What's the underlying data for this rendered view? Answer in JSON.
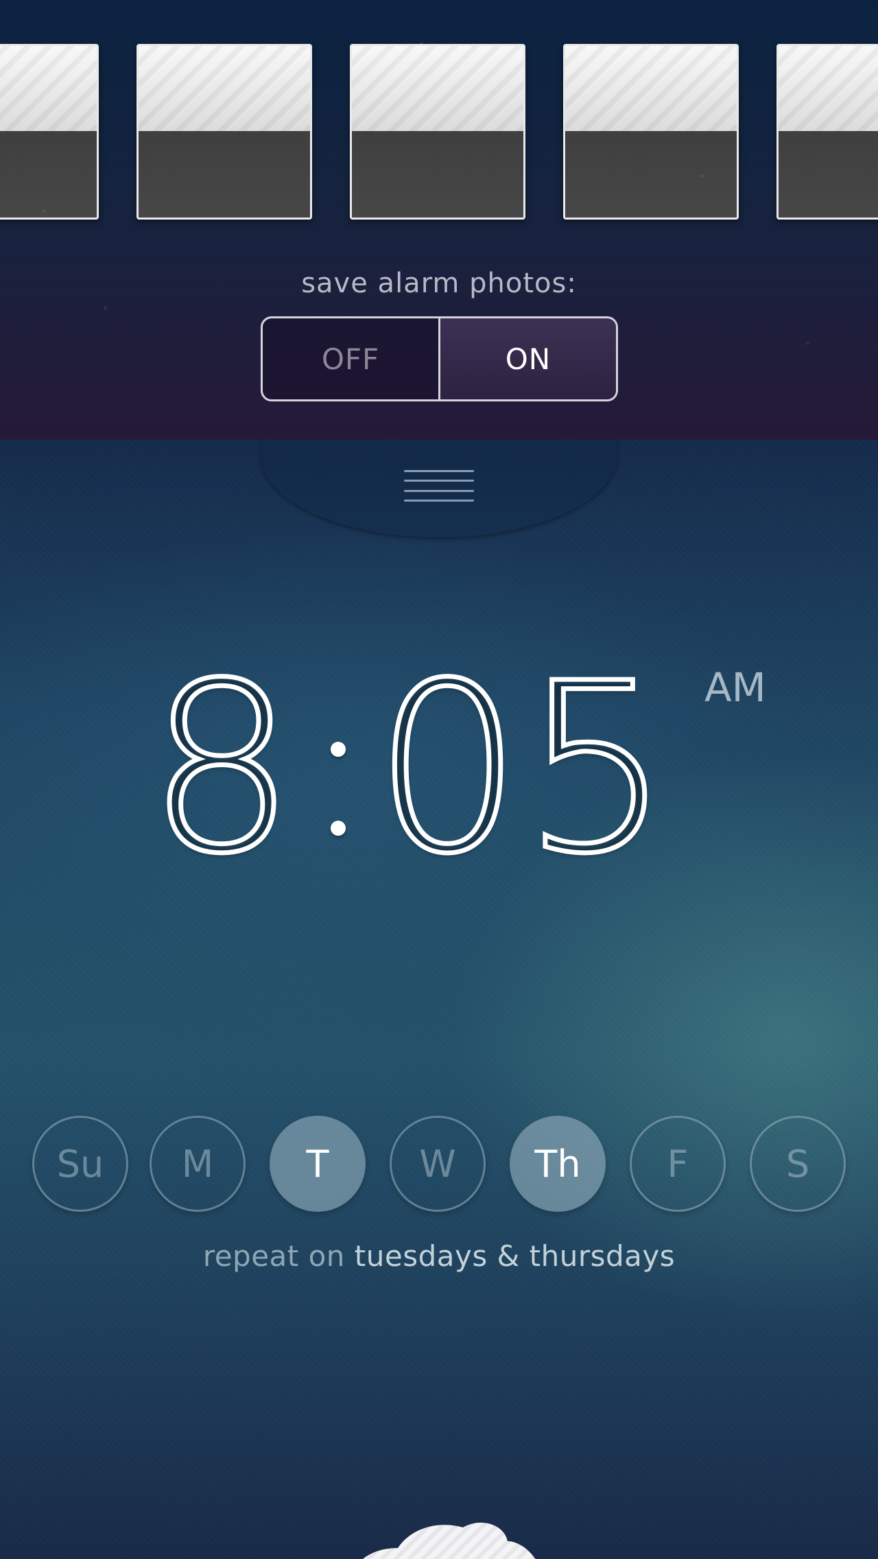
{
  "photos": {
    "slots": [
      "photo-1",
      "photo-2",
      "photo-3",
      "photo-4",
      "photo-5"
    ],
    "save_label": "save alarm photos:",
    "toggle": {
      "off_label": "OFF",
      "on_label": "ON",
      "selected": "ON"
    }
  },
  "alarm": {
    "hour": "8",
    "colon": ":",
    "minutes": "05",
    "period": "AM",
    "days": [
      {
        "label": "Su",
        "selected": false
      },
      {
        "label": "M",
        "selected": false
      },
      {
        "label": "T",
        "selected": true
      },
      {
        "label": "W",
        "selected": false
      },
      {
        "label": "Th",
        "selected": true
      },
      {
        "label": "F",
        "selected": false
      },
      {
        "label": "S",
        "selected": false
      }
    ],
    "repeat_prefix": "repeat on",
    "repeat_days": "tuesdays & thursdays"
  },
  "icons": {
    "menu": "menu-icon",
    "cloud": "cloud-icon"
  },
  "colors": {
    "toggle_border": "#d6d3de",
    "selected_day": "#a0b9c8",
    "time_stroke": "#ffffff"
  }
}
